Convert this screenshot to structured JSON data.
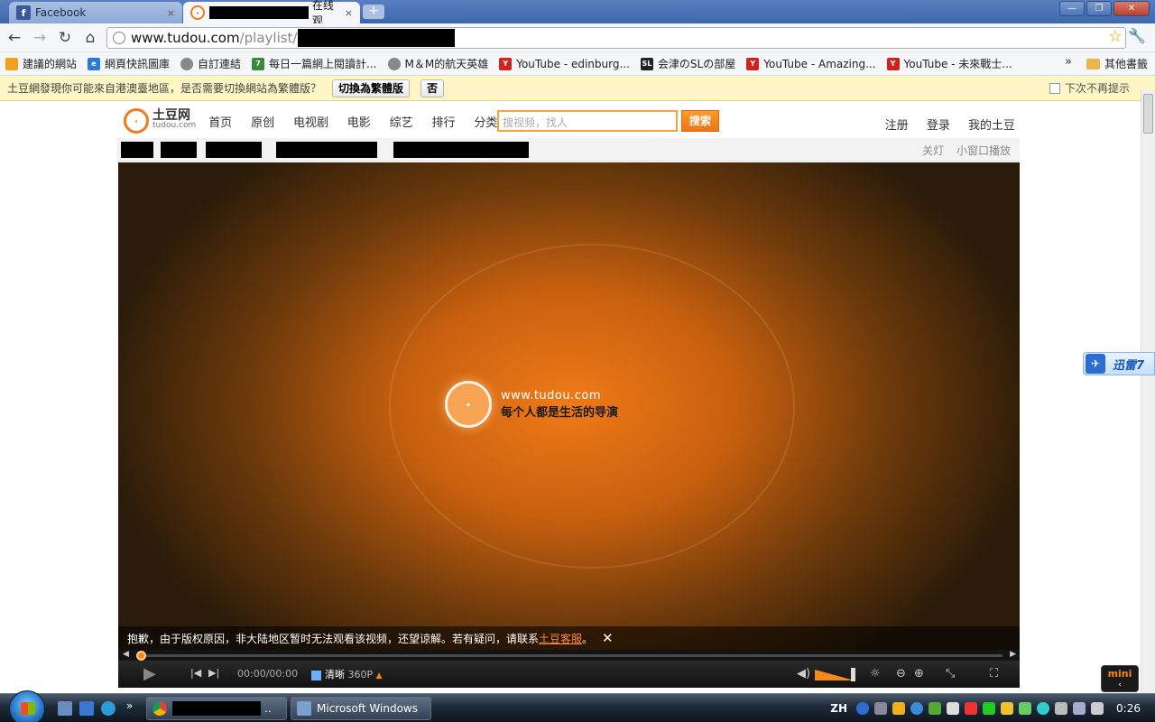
{
  "browser": {
    "tabs": [
      {
        "title": "Facebook",
        "close": "×"
      },
      {
        "title": "在线观",
        "close": "×"
      }
    ],
    "new_tab": "+",
    "window_buttons": [
      "—",
      "❐",
      "✕"
    ],
    "address": {
      "host": "www.tudou.com",
      "path": "/playlist/"
    },
    "nav_icons": [
      "back-icon",
      "forward-icon",
      "reload-icon",
      "home-icon",
      "star-icon",
      "wrench-icon"
    ]
  },
  "bookmarks": {
    "items": [
      {
        "label": "建議的網站",
        "icon": "lightbulb",
        "color": "#f0a020"
      },
      {
        "label": "網頁快訊圖庫",
        "icon": "ie",
        "color": "#2a7ad8"
      },
      {
        "label": "自訂連結",
        "icon": "globe",
        "color": "#888888"
      },
      {
        "label": "每日一篇網上閱讀計...",
        "icon": "page",
        "color": "#3a8a3a"
      },
      {
        "label": "M＆M的航天英雄",
        "icon": "globe",
        "color": "#888888"
      },
      {
        "label": "YouTube - edinburg...",
        "icon": "youtube",
        "color": "#d0231e"
      },
      {
        "label": "会津のSLの部屋",
        "icon": "sl",
        "color": "#222222"
      },
      {
        "label": "YouTube - Amazing...",
        "icon": "youtube",
        "color": "#d0231e"
      },
      {
        "label": "YouTube - 未來戰士...",
        "icon": "youtube",
        "color": "#d0231e"
      }
    ],
    "more": "»",
    "other": "其他書籤"
  },
  "infobar": {
    "message": "土豆網發現你可能來自港澳臺地區，是否需要切換網站為繁體版？",
    "switch_button": "切換為繁體版",
    "no_button": "否",
    "dont_show": "下次不再提示"
  },
  "site": {
    "logo_cn": "土豆网",
    "logo_en": "tudou.com",
    "nav": [
      "首页",
      "原创",
      "电视剧",
      "电影",
      "综艺",
      "排行",
      "分类 ▾"
    ],
    "search_placeholder": "搜视频，找人",
    "search_button": "搜索",
    "user_links": [
      "注册",
      "登录",
      "我的土豆"
    ],
    "player_controls_top": [
      "关灯",
      "小窗口播放"
    ]
  },
  "player": {
    "center_url": "www.tudou.com",
    "slogan": "每个人都是生活的导演",
    "notice_prefix": "抱歉，由于版权原因，非大陆地区暂时无法观看该视频，还望谅解。若有疑问，请联系",
    "notice_link": "土豆客服",
    "notice_suffix": "。",
    "notice_close": "✕",
    "time": "00:00/00:00",
    "quality_label": "清晰",
    "quality_res": "360P",
    "progress": 0,
    "volume": 0.9
  },
  "side": {
    "xunlei": "迅雷7",
    "mini_label": "mini",
    "mini_arrow": "‹"
  },
  "taskbar": {
    "items": [
      "..",
      "Microsoft Windows"
    ],
    "lang": "ZH",
    "clock": "0:26"
  }
}
